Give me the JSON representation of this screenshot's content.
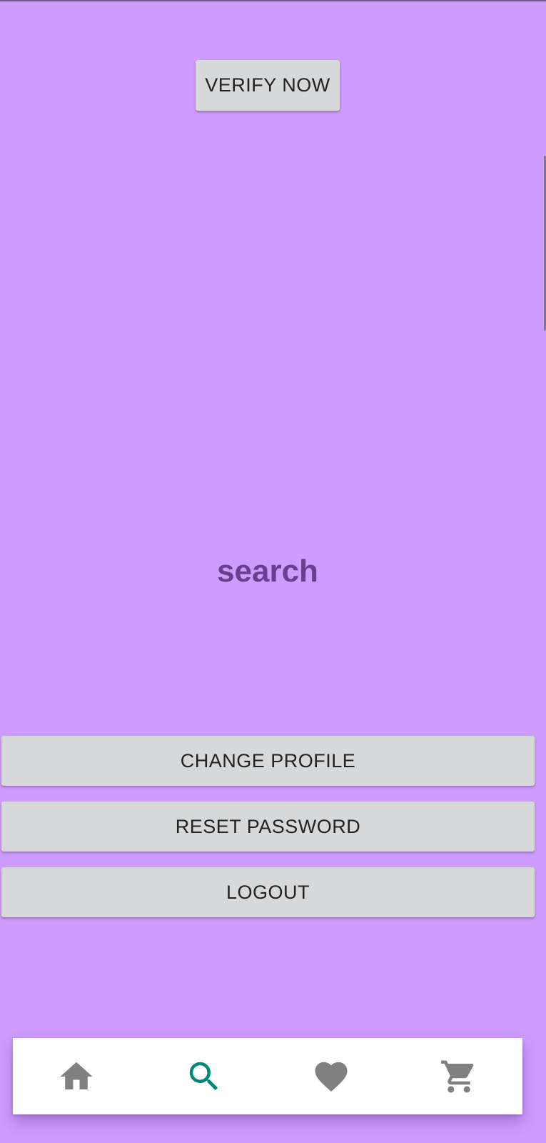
{
  "verify": {
    "label": "VERIFY NOW"
  },
  "page": {
    "title": "search"
  },
  "actions": {
    "change_profile": "CHANGE PROFILE",
    "reset_password": "RESET PASSWORD",
    "logout": "LOGOUT"
  },
  "bottom_nav": {
    "active": "search",
    "items": [
      {
        "id": "home",
        "icon": "home-icon"
      },
      {
        "id": "search",
        "icon": "search-icon"
      },
      {
        "id": "favorites",
        "icon": "heart-icon"
      },
      {
        "id": "cart",
        "icon": "cart-icon"
      }
    ]
  },
  "colors": {
    "background": "#cd9cfc",
    "title": "#6a3f92",
    "button_bg": "#d7d8d9",
    "nav_active": "#00897b",
    "nav_inactive": "#808080"
  }
}
